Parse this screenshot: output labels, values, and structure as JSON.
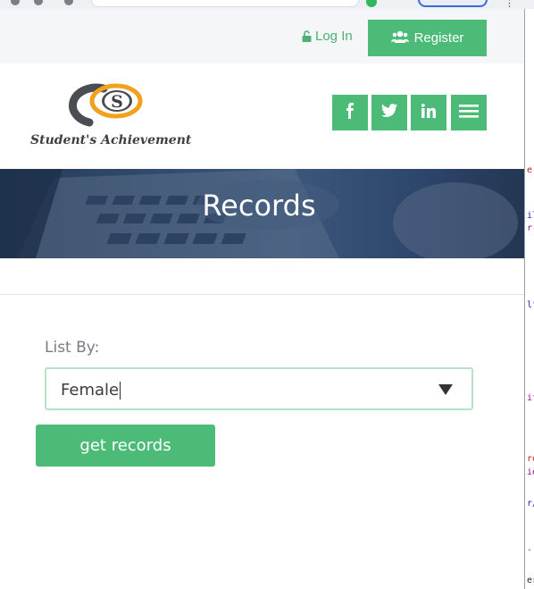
{
  "topbar": {
    "login_label": "Log In",
    "register_label": "Register"
  },
  "brand": {
    "logo_letter": "S",
    "name": "Student's Achievement",
    "colors": {
      "accent": "#4cbb77",
      "orange": "#f0a21c",
      "gray": "#4a4d52"
    }
  },
  "social": [
    {
      "icon": "facebook-icon",
      "label": "f"
    },
    {
      "icon": "twitter-icon",
      "label": "twitter"
    },
    {
      "icon": "linkedin-icon",
      "label": "in"
    },
    {
      "icon": "hamburger-menu-icon",
      "label": "menu"
    }
  ],
  "banner": {
    "title": "Records"
  },
  "form": {
    "label": "List By:",
    "selected": "Female",
    "button_label": "get records"
  },
  "devtools": {
    "fragments": [
      "e",
      "il",
      "r-",
      "l\"",
      "it",
      "ro",
      "ie",
      "r/",
      "-",
      "er"
    ]
  }
}
